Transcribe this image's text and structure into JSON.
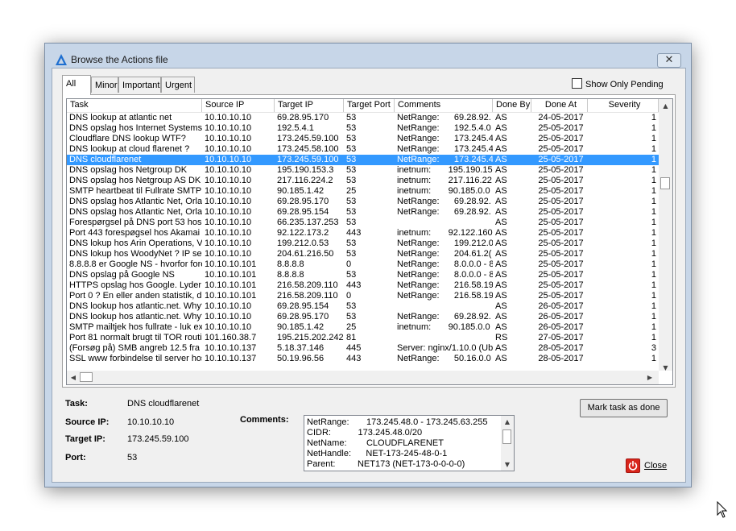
{
  "window": {
    "title": "Browse the Actions file",
    "close_glyph": "✕"
  },
  "tabs": [
    "All",
    "Minor",
    "Important",
    "Urgent"
  ],
  "show_only_pending": {
    "label": "Show Only Pending",
    "checked": false
  },
  "columns": [
    "Task",
    "Source IP",
    "Target IP",
    "Target Port",
    "Comments",
    "Done By",
    "Done At",
    "Severity"
  ],
  "rows": [
    {
      "task": "DNS lookup at atlantic net",
      "src": "10.10.10.10",
      "tgt": "69.28.95.170",
      "port": "53",
      "comment": "NetRange:      69.28.92.",
      "by": "AS",
      "at": "24-05-2017",
      "sev": "1"
    },
    {
      "task": "DNS opslag hos Internet Systems C",
      "src": "10.10.10.10",
      "tgt": "192.5.4.1",
      "port": "53",
      "comment": "NetRange:      192.5.4.0",
      "by": "AS",
      "at": "25-05-2017",
      "sev": "1"
    },
    {
      "task": "Cloudflare DNS lookup WTF?",
      "src": "10.10.10.10",
      "tgt": "173.245.59.100",
      "port": "53",
      "comment": "NetRange:      173.245.4",
      "by": "AS",
      "at": "25-05-2017",
      "sev": "1"
    },
    {
      "task": "DNS lookup at cloud flarenet ?",
      "src": "10.10.10.10",
      "tgt": "173.245.58.100",
      "port": "53",
      "comment": "NetRange:      173.245.4",
      "by": "AS",
      "at": "25-05-2017",
      "sev": "1"
    },
    {
      "task": "DNS cloudflarenet",
      "src": "10.10.10.10",
      "tgt": "173.245.59.100",
      "port": "53",
      "comment": "NetRange:      173.245.4",
      "by": "AS",
      "at": "25-05-2017",
      "sev": "1",
      "selected": true
    },
    {
      "task": "DNS opslag hos Netgroup DK",
      "src": "10.10.10.10",
      "tgt": "195.190.153.3",
      "port": "53",
      "comment": "inetnum:       195.190.15",
      "by": "AS",
      "at": "25-05-2017",
      "sev": "1"
    },
    {
      "task": "DNS opslag hos Netgroup AS DK",
      "src": "10.10.10.10",
      "tgt": "217.116.224.2",
      "port": "53",
      "comment": "inetnum:       217.116.22",
      "by": "AS",
      "at": "25-05-2017",
      "sev": "1"
    },
    {
      "task": "SMTP heartbeat til Fullrate SMTP s",
      "src": "10.10.10.10",
      "tgt": "90.185.1.42",
      "port": "25",
      "comment": "inetnum:       90.185.0.0",
      "by": "AS",
      "at": "25-05-2017",
      "sev": "1"
    },
    {
      "task": "DNS opslag hos Atlantic Net, Orlan",
      "src": "10.10.10.10",
      "tgt": "69.28.95.170",
      "port": "53",
      "comment": "NetRange:      69.28.92.",
      "by": "AS",
      "at": "25-05-2017",
      "sev": "1"
    },
    {
      "task": "DNS opslag hos Atlantic Net, Orlan",
      "src": "10.10.10.10",
      "tgt": "69.28.95.154",
      "port": "53",
      "comment": "NetRange:      69.28.92.",
      "by": "AS",
      "at": "25-05-2017",
      "sev": "1"
    },
    {
      "task": "Forespørgsel på DNS port 53 hos A",
      "src": "10.10.10.10",
      "tgt": "66.235.137.253",
      "port": "53",
      "comment": "",
      "by": "AS",
      "at": "25-05-2017",
      "sev": "1"
    },
    {
      "task": "Port 443 forespøgsel hos Akamai (E",
      "src": "10.10.10.10",
      "tgt": "92.122.173.2",
      "port": "443",
      "comment": "inetnum:       92.122.160",
      "by": "AS",
      "at": "25-05-2017",
      "sev": "1"
    },
    {
      "task": "DNS lokup hos Arin Operations, VA",
      "src": "10.10.10.10",
      "tgt": "199.212.0.53",
      "port": "53",
      "comment": "NetRange:      199.212.0",
      "by": "AS",
      "at": "25-05-2017",
      "sev": "1"
    },
    {
      "task": "DNS lokup hos WoodyNet ? IP ser",
      "src": "10.10.10.10",
      "tgt": "204.61.216.50",
      "port": "53",
      "comment": "NetRange:      204.61.2(",
      "by": "AS",
      "at": "25-05-2017",
      "sev": "1"
    },
    {
      "task": "8.8.8.8 er Google NS - hvorfor fore",
      "src": "10.10.10.101",
      "tgt": "8.8.8.8",
      "port": "0",
      "comment": "NetRange:      8.0.0.0 - 8",
      "by": "AS",
      "at": "25-05-2017",
      "sev": "1"
    },
    {
      "task": "DNS opslag på Google NS",
      "src": "10.10.10.101",
      "tgt": "8.8.8.8",
      "port": "53",
      "comment": "NetRange:      8.0.0.0 - 8",
      "by": "AS",
      "at": "25-05-2017",
      "sev": "1"
    },
    {
      "task": "HTTPS opslag hos Google. Lyder l",
      "src": "10.10.10.101",
      "tgt": "216.58.209.110",
      "port": "443",
      "comment": "NetRange:      216.58.19",
      "by": "AS",
      "at": "25-05-2017",
      "sev": "1"
    },
    {
      "task": "Port 0 ? En eller anden statistik, de",
      "src": "10.10.10.101",
      "tgt": "216.58.209.110",
      "port": "0",
      "comment": "NetRange:      216.58.19",
      "by": "AS",
      "at": "25-05-2017",
      "sev": "1"
    },
    {
      "task": "DNS lookup hos atlantic.net. Why?",
      "src": "10.10.10.10",
      "tgt": "69.28.95.154",
      "port": "53",
      "comment": "",
      "by": "AS",
      "at": "26-05-2017",
      "sev": "1"
    },
    {
      "task": "DNS lookup hos atlantic.net. Why?",
      "src": "10.10.10.10",
      "tgt": "69.28.95.170",
      "port": "53",
      "comment": "NetRange:      69.28.92.",
      "by": "AS",
      "at": "26-05-2017",
      "sev": "1"
    },
    {
      "task": "SMTP mailtjek hos fullrate - luk exc",
      "src": "10.10.10.10",
      "tgt": "90.185.1.42",
      "port": "25",
      "comment": "inetnum:       90.185.0.0",
      "by": "AS",
      "at": "26-05-2017",
      "sev": "1"
    },
    {
      "task": "Port 81 normalt brugt til TOR routin",
      "src": "101.160.38.7",
      "tgt": "195.215.202.242",
      "port": "81",
      "comment": "",
      "by": "RS",
      "at": "27-05-2017",
      "sev": "1"
    },
    {
      "task": "(Forsøg på) SMB angreb 12.5 fra m",
      "src": "10.10.10.137",
      "tgt": "5.18.37.146",
      "port": "445",
      "comment": "Server: nginx/1.10.0 (Ub",
      "by": "AS",
      "at": "28-05-2017",
      "sev": "3"
    },
    {
      "task": "SSL www forbindelse til server hos",
      "src": "10.10.10.137",
      "tgt": "50.19.96.56",
      "port": "443",
      "comment": "NetRange:      50.16.0.0",
      "by": "AS",
      "at": "28-05-2017",
      "sev": "1"
    }
  ],
  "details": {
    "task_label": "Task:",
    "task": "DNS cloudflarenet",
    "source_label": "Source IP:",
    "source": "10.10.10.10",
    "target_label": "Target IP:",
    "target": "173.245.59.100",
    "port_label": "Port:",
    "port": "53",
    "comments_label": "Comments:",
    "comments": [
      "NetRange:       173.245.48.0 - 173.245.63.255",
      "CIDR:           173.245.48.0/20",
      "NetName:        CLOUDFLARENET",
      "NetHandle:      NET-173-245-48-0-1",
      "Parent:         NET173 (NET-173-0-0-0-0)"
    ]
  },
  "buttons": {
    "mark_done": "Mark task as done",
    "close": "Close"
  },
  "colors": {
    "selection": "#3399ff",
    "close_icon": "#d9261c",
    "frame": "#c7d6e8"
  },
  "icons": {
    "app": "triangle-logo-icon",
    "close": "power-icon",
    "cursor": "mouse-cursor-icon"
  }
}
